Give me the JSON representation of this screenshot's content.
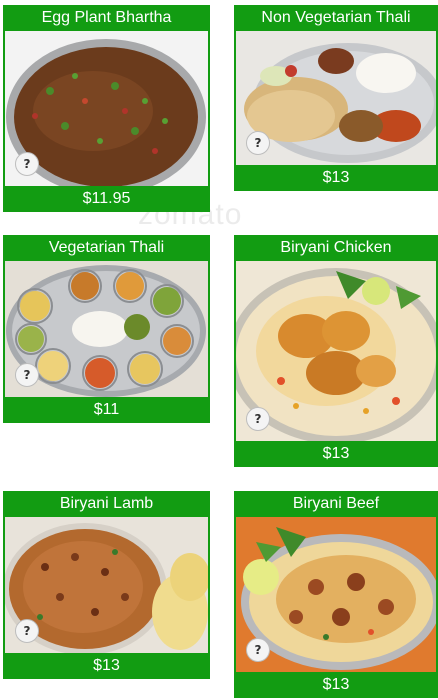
{
  "watermark": "zomato",
  "help_glyph": "?",
  "items": [
    {
      "name": "Egg Plant Bhartha",
      "price": "$11.95"
    },
    {
      "name": "Non Vegetarian Thali",
      "price": "$13"
    },
    {
      "name": "Vegetarian Thali",
      "price": "$11"
    },
    {
      "name": "Biryani Chicken",
      "price": "$13"
    },
    {
      "name": "Biryani Lamb",
      "price": "$13"
    },
    {
      "name": "Biryani Beef",
      "price": "$13"
    }
  ]
}
